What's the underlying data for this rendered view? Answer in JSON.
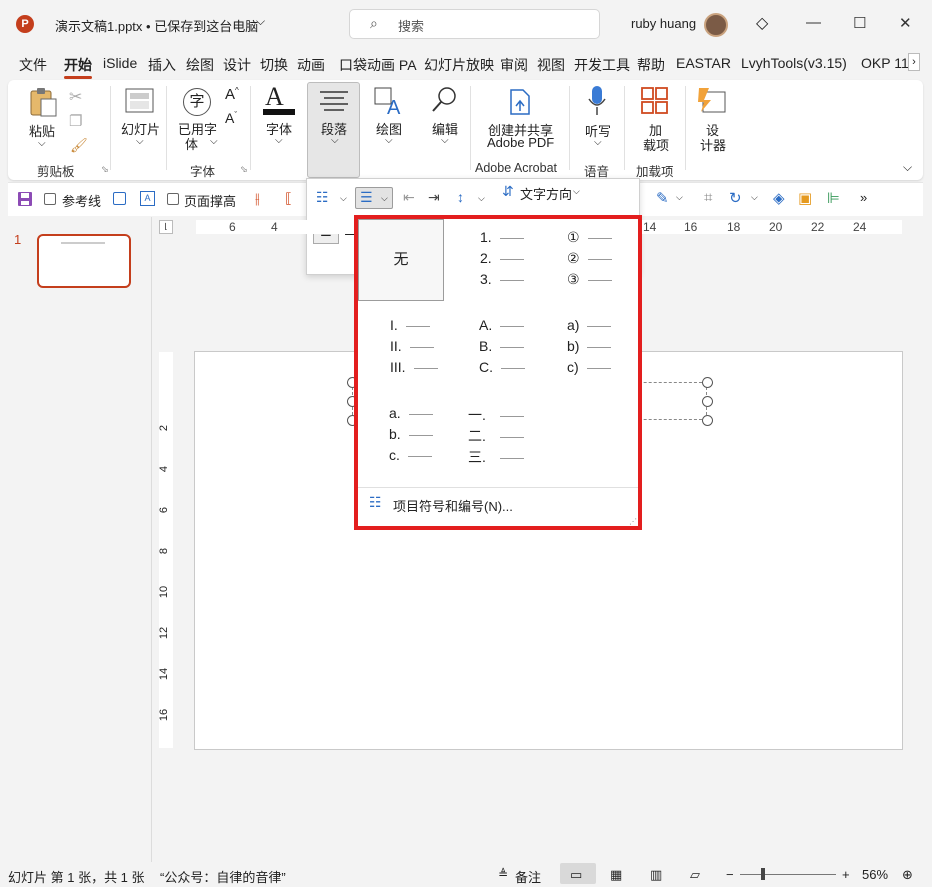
{
  "app": {
    "title": "演示文稿1.pptx • 已保存到这台电脑",
    "search_placeholder": "搜索",
    "user_name": "ruby huang"
  },
  "tabs": [
    "文件",
    "开始",
    "iSlide",
    "插入",
    "绘图",
    "设计",
    "切换",
    "动画",
    "口袋动画 PA",
    "幻灯片放映",
    "审阅",
    "视图",
    "开发工具",
    "帮助",
    "EASTAR",
    "LvyhTools(v3.15)",
    "OKP 11"
  ],
  "ribbon": {
    "paste": "粘贴",
    "slides": "幻灯片",
    "common_font_1": "已用字",
    "common_font_2": "体",
    "font": "字体",
    "paragraph": "段落",
    "drawing": "绘图",
    "editing": "编辑",
    "create_share_1": "创建并共享",
    "create_share_2": "Adobe PDF",
    "dictate": "听写",
    "addins_1": "加",
    "addins_2": "载项",
    "designer_1": "设",
    "designer_2": "计器",
    "group_clipboard": "剪贴板",
    "group_font": "字体",
    "group_adobe": "Adobe Acrobat",
    "group_voice": "语音",
    "group_addins": "加载项"
  },
  "para_popup": {
    "text_direction": "文字方向"
  },
  "qat": {
    "guides": "参考线",
    "page_fill": "页面撑高"
  },
  "slide_panel": {
    "slide_number": "1"
  },
  "ruler_h": [
    "6",
    "4",
    "14",
    "16",
    "18",
    "20",
    "22",
    "24"
  ],
  "ruler_v": [
    "2",
    "4",
    "6",
    "8",
    "10",
    "12",
    "14",
    "16"
  ],
  "numbering": {
    "none_label": "无",
    "col1": [
      [
        "1.",
        "2.",
        "3."
      ],
      [
        "I.",
        "II.",
        "III."
      ],
      [
        "a.",
        "b.",
        "c."
      ]
    ],
    "col2": [
      [
        "①",
        "②",
        "③"
      ],
      [
        "A.",
        "B.",
        "C."
      ],
      [
        "一.",
        "二.",
        "三."
      ]
    ],
    "col3": [
      [
        "a)",
        "b)",
        "c)"
      ]
    ],
    "bullets_and_numbering": "项目符号和编号(N)..."
  },
  "status": {
    "slide_info": "幻灯片 第 1 张，共 1 张",
    "note_text": "“公众号：自律的音律”",
    "notes": "备注",
    "zoom": "56%"
  }
}
